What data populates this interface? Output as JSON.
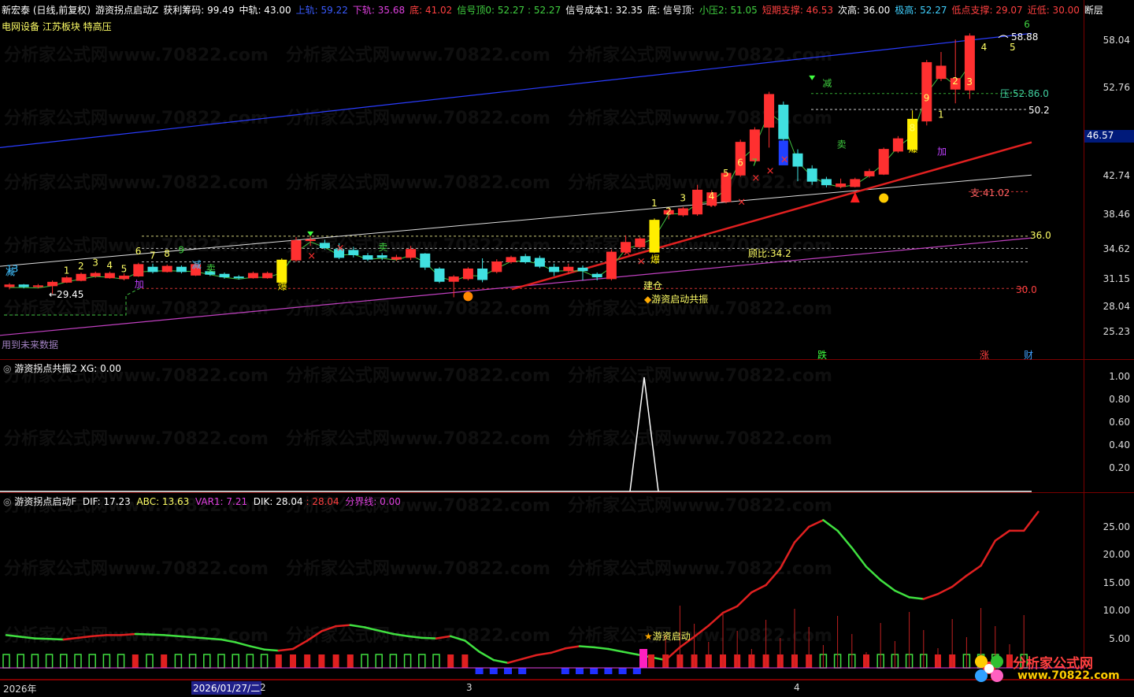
{
  "header": {
    "items": [
      {
        "text": "新宏泰 (日线,前复权)",
        "color": "#ffffff"
      },
      {
        "text": "游资拐点启动Z",
        "color": "#ffffff"
      },
      {
        "text": "获利筹码: 99.49",
        "color": "#ffffff"
      },
      {
        "text": "中轨: 43.00",
        "color": "#ffffff"
      },
      {
        "text": "上轨: 59.22",
        "color": "#3a5bff"
      },
      {
        "text": "下轨: 35.68",
        "color": "#e040e0"
      },
      {
        "text": "底: 41.02",
        "color": "#ff4040"
      },
      {
        "text": "信号顶0: 52.27 : 52.27",
        "color": "#40d040"
      },
      {
        "text": "信号成本1: 32.35",
        "color": "#ffffff"
      },
      {
        "text": "底: 信号顶:",
        "color": "#ffffff"
      },
      {
        "text": "小压2: 51.05",
        "color": "#40d040"
      },
      {
        "text": "短期支撑: 46.53",
        "color": "#ff4040"
      },
      {
        "text": "次高: 36.00",
        "color": "#ffffff"
      },
      {
        "text": "极高: 52.27",
        "color": "#40d0ff"
      },
      {
        "text": "低点支撑: 29.07",
        "color": "#ff4040"
      },
      {
        "text": "近低: 30.00",
        "color": "#ff4040"
      },
      {
        "text": "断层",
        "color": "#ffffff"
      }
    ],
    "sectors": "电网设备 江苏板块 特高压"
  },
  "panel1": {
    "y_ticks": [
      "58.04",
      "52.76",
      "46.57",
      "42.74",
      "38.46",
      "34.62",
      "31.15",
      "28.04",
      "25.23"
    ],
    "current_price": "46.57",
    "labels": {
      "hi_price": "58.88",
      "low_price": "←29.45",
      "support": "支:41.02",
      "pressure": "压:52.86.0",
      "ratio": "顾比:34.2",
      "level_36": "36.0",
      "level_30": "30.0",
      "level_50": "50.2",
      "launch": "游资启动共振",
      "build_pos": "建仓",
      "future": "用到未来数据",
      "die": "跌",
      "zhang": "涨",
      "cai": "财",
      "jian": "减",
      "jia": "加",
      "bao": "爆",
      "mai": "卖"
    },
    "count_labels": [
      "13",
      "1",
      "2",
      "3",
      "4",
      "5",
      "6",
      "7",
      "8",
      "9",
      "1",
      "2",
      "3",
      "4",
      "5",
      "6",
      "7",
      "8",
      "9",
      "1",
      "2",
      "3",
      "4",
      "5",
      "6",
      "8",
      "9"
    ]
  },
  "panel2": {
    "title": "游资拐点共振2",
    "xg": "XG: 0.00",
    "y_ticks": [
      "1.00",
      "0.80",
      "0.60",
      "0.40",
      "0.20"
    ]
  },
  "panel3": {
    "title": "游资拐点启动F",
    "dif": "DIF: 17.23",
    "abc": "ABC: 13.63",
    "var1": "VAR1: 7.21",
    "dik": "DIK: 28.04",
    "dik2": ": 28.04",
    "fen": "分界线: 0.00",
    "y_ticks": [
      "25.00",
      "20.00",
      "15.00",
      "10.00",
      "5.00"
    ],
    "launch": "游资启动"
  },
  "xaxis": {
    "labels": [
      "2026年",
      "2026/01/27/二",
      "2",
      "3",
      "4"
    ]
  },
  "watermark": "分析家公式网www.70822.com",
  "logo": {
    "cn": "分析家公式网",
    "url": "www.70822.com"
  },
  "chart_data": [
    {
      "type": "candlestick",
      "title": "新宏泰 (日线,前复权)",
      "ylim": [
        23.5,
        60
      ],
      "y_ticks": [
        58.04,
        52.76,
        46.57,
        42.74,
        38.46,
        34.62,
        31.15,
        28.04,
        25.23
      ],
      "candles": [
        {
          "o": 30.3,
          "c": 30.5,
          "h": 30.7,
          "l": 30.0
        },
        {
          "o": 30.5,
          "c": 30.3,
          "h": 30.6,
          "l": 30.1
        },
        {
          "o": 30.3,
          "c": 30.4,
          "h": 30.6,
          "l": 30.1
        },
        {
          "o": 30.4,
          "c": 30.8,
          "h": 31.0,
          "l": 29.5
        },
        {
          "o": 30.8,
          "c": 31.3,
          "h": 31.5,
          "l": 30.7
        },
        {
          "o": 31.0,
          "c": 31.7,
          "h": 31.9,
          "l": 30.9
        },
        {
          "o": 31.5,
          "c": 31.8,
          "h": 32.0,
          "l": 31.3
        },
        {
          "o": 31.3,
          "c": 31.8,
          "h": 32.0,
          "l": 31.2
        },
        {
          "o": 31.2,
          "c": 31.5,
          "h": 31.8,
          "l": 31.0
        },
        {
          "o": 31.5,
          "c": 32.8,
          "h": 33.0,
          "l": 31.4
        },
        {
          "o": 32.5,
          "c": 32.0,
          "h": 32.9,
          "l": 31.8
        },
        {
          "o": 32.0,
          "c": 32.6,
          "h": 32.8,
          "l": 31.9
        },
        {
          "o": 32.5,
          "c": 32.0,
          "h": 32.7,
          "l": 31.8
        },
        {
          "o": 31.6,
          "c": 32.8,
          "h": 33.0,
          "l": 31.5
        },
        {
          "o": 32.0,
          "c": 31.7,
          "h": 32.2,
          "l": 31.5
        },
        {
          "o": 31.7,
          "c": 31.4,
          "h": 31.9,
          "l": 31.2
        },
        {
          "o": 31.4,
          "c": 31.3,
          "h": 31.6,
          "l": 31.1
        },
        {
          "o": 31.3,
          "c": 31.8,
          "h": 32.0,
          "l": 31.2
        },
        {
          "o": 31.3,
          "c": 31.8,
          "h": 32.0,
          "l": 31.2
        },
        {
          "o": 30.8,
          "c": 33.3,
          "h": 33.5,
          "l": 30.6
        },
        {
          "o": 33.3,
          "c": 35.5,
          "h": 35.9,
          "l": 33.1
        },
        {
          "o": 35.5,
          "c": 35.6,
          "h": 36.0,
          "l": 34.9
        },
        {
          "o": 35.2,
          "c": 34.7,
          "h": 35.6,
          "l": 34.5
        },
        {
          "o": 34.5,
          "c": 33.6,
          "h": 35.2,
          "l": 33.4
        },
        {
          "o": 34.4,
          "c": 33.9,
          "h": 34.8,
          "l": 33.6
        },
        {
          "o": 33.8,
          "c": 33.4,
          "h": 34.1,
          "l": 33.2
        },
        {
          "o": 33.8,
          "c": 33.6,
          "h": 34.1,
          "l": 33.3
        },
        {
          "o": 33.4,
          "c": 33.6,
          "h": 33.9,
          "l": 33.2
        },
        {
          "o": 33.6,
          "c": 34.5,
          "h": 34.9,
          "l": 33.3
        },
        {
          "o": 34.0,
          "c": 32.5,
          "h": 34.1,
          "l": 32.2
        },
        {
          "o": 32.3,
          "c": 30.9,
          "h": 32.5,
          "l": 30.7
        },
        {
          "o": 30.9,
          "c": 31.4,
          "h": 31.6,
          "l": 29.1
        },
        {
          "o": 31.2,
          "c": 32.3,
          "h": 32.5,
          "l": 31.0
        },
        {
          "o": 32.3,
          "c": 31.1,
          "h": 33.5,
          "l": 30.8
        },
        {
          "o": 32.0,
          "c": 33.1,
          "h": 33.4,
          "l": 31.8
        },
        {
          "o": 33.1,
          "c": 33.6,
          "h": 33.8,
          "l": 32.9
        },
        {
          "o": 33.7,
          "c": 33.1,
          "h": 34.0,
          "l": 32.9
        },
        {
          "o": 33.5,
          "c": 32.6,
          "h": 33.8,
          "l": 32.4
        },
        {
          "o": 32.5,
          "c": 32.0,
          "h": 32.9,
          "l": 31.5
        },
        {
          "o": 32.1,
          "c": 32.5,
          "h": 32.9,
          "l": 31.7
        },
        {
          "o": 32.4,
          "c": 32.1,
          "h": 32.7,
          "l": 31.0
        },
        {
          "o": 31.7,
          "c": 31.4,
          "h": 31.9,
          "l": 31.0
        },
        {
          "o": 31.2,
          "c": 34.2,
          "h": 34.5,
          "l": 31.0
        },
        {
          "o": 34.2,
          "c": 35.3,
          "h": 36.1,
          "l": 34.0
        },
        {
          "o": 34.8,
          "c": 35.7,
          "h": 35.9,
          "l": 34.6
        },
        {
          "o": 34.2,
          "c": 37.8,
          "h": 38.0,
          "l": 34.1
        },
        {
          "o": 38.5,
          "c": 38.9,
          "h": 39.2,
          "l": 37.9
        },
        {
          "o": 38.4,
          "c": 39.1,
          "h": 39.3,
          "l": 38.2
        },
        {
          "o": 38.5,
          "c": 41.2,
          "h": 41.8,
          "l": 38.3
        },
        {
          "o": 39.5,
          "c": 40.9,
          "h": 41.2,
          "l": 39.3
        },
        {
          "o": 39.9,
          "c": 43.1,
          "h": 43.4,
          "l": 39.7
        },
        {
          "o": 42.9,
          "c": 46.6,
          "h": 46.9,
          "l": 42.7
        },
        {
          "o": 44.5,
          "c": 48.0,
          "h": 48.3,
          "l": 44.3
        },
        {
          "o": 48.3,
          "c": 52.0,
          "h": 52.3,
          "l": 46.0
        },
        {
          "o": 50.8,
          "c": 47.0,
          "h": 51.2,
          "l": 46.5
        },
        {
          "o": 45.3,
          "c": 43.9,
          "h": 45.8,
          "l": 42.2
        },
        {
          "o": 43.6,
          "c": 42.2,
          "h": 44.0,
          "l": 41.8
        },
        {
          "o": 42.4,
          "c": 41.8,
          "h": 42.7,
          "l": 41.5
        },
        {
          "o": 41.6,
          "c": 41.9,
          "h": 42.5,
          "l": 41.4
        },
        {
          "o": 41.6,
          "c": 42.4,
          "h": 42.6,
          "l": 41.5
        },
        {
          "o": 42.8,
          "c": 43.3,
          "h": 43.6,
          "l": 42.6
        },
        {
          "o": 43.0,
          "c": 45.8,
          "h": 46.0,
          "l": 42.9
        },
        {
          "o": 45.6,
          "c": 47.0,
          "h": 47.3,
          "l": 45.4
        },
        {
          "o": 45.8,
          "c": 49.2,
          "h": 50.2,
          "l": 45.6
        },
        {
          "o": 49.0,
          "c": 55.6,
          "h": 55.9,
          "l": 48.5
        },
        {
          "o": 53.8,
          "c": 55.2,
          "h": 56.8,
          "l": 53.5
        },
        {
          "o": 52.6,
          "c": 53.8,
          "h": 58.2,
          "l": 51.0
        },
        {
          "o": 52.5,
          "c": 58.6,
          "h": 58.9,
          "l": 51.5
        }
      ],
      "lines": {
        "upper": [
          46.0,
          58.9
        ],
        "lower": [
          24.8,
          35.8
        ],
        "middle": [
          32.6,
          42.9
        ]
      }
    },
    {
      "type": "line",
      "title": "游资拐点共振2",
      "ylim": [
        0,
        1.1
      ],
      "series": [
        {
          "name": "XG",
          "spike_at_bar": 44,
          "values": [
            0,
            1,
            0
          ]
        }
      ]
    },
    {
      "type": "line",
      "title": "游资拐点启动F",
      "ylim": [
        -2,
        28
      ],
      "series": [
        {
          "name": "DIK",
          "values": [
            5.8,
            5.5,
            5.2,
            5.1,
            5.0,
            5.3,
            5.6,
            5.8,
            5.8,
            6.0,
            5.9,
            5.8,
            5.6,
            5.4,
            5.2,
            5.0,
            4.5,
            3.8,
            3.2,
            3.0,
            3.3,
            4.8,
            6.5,
            7.4,
            7.6,
            7.2,
            6.6,
            6.0,
            5.6,
            5.3,
            5.2,
            5.6,
            4.8,
            2.8,
            1.3,
            0.8,
            1.5,
            2.2,
            2.6,
            3.4,
            3.8,
            3.6,
            3.3,
            2.8,
            2.3,
            1.8,
            1.3,
            3.6,
            5.5,
            7.5,
            9.8,
            11.0,
            13.5,
            14.8,
            17.8,
            22.5,
            25.3,
            26.5,
            24.6,
            21.5,
            18.1,
            15.7,
            13.8,
            12.6,
            12.3,
            13.2,
            14.5,
            16.5,
            18.3,
            22.8,
            24.6,
            24.6,
            28.0
          ]
        }
      ]
    }
  ]
}
